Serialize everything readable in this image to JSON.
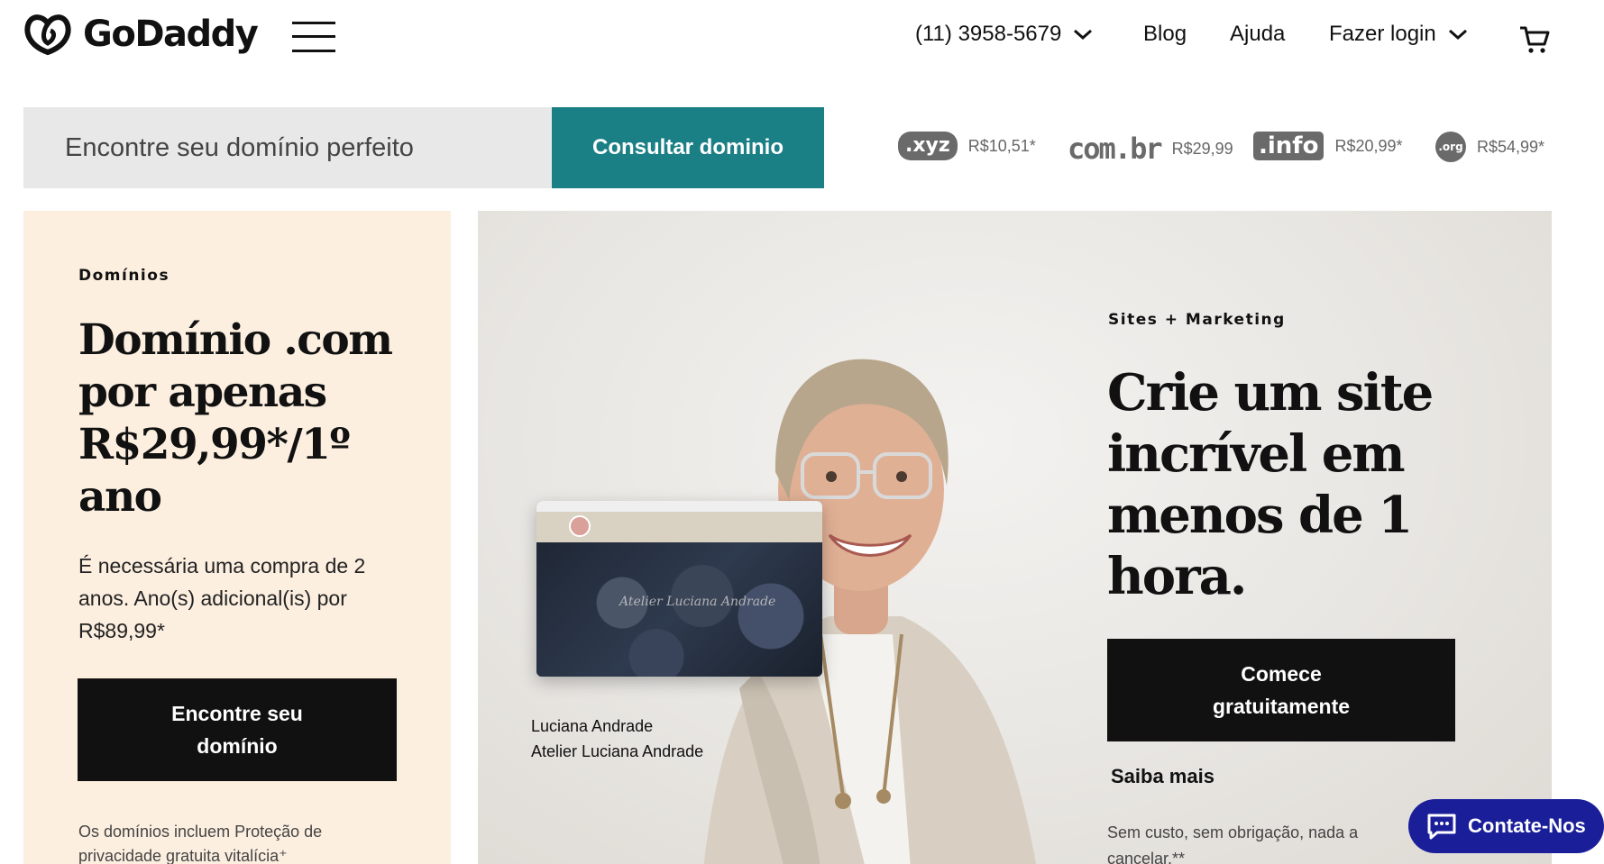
{
  "header": {
    "logo_text": "GoDaddy",
    "phone": "(11) 3958-5679",
    "blog": "Blog",
    "help": "Ajuda",
    "login": "Fazer login"
  },
  "search": {
    "placeholder": "Encontre seu domínio perfeito",
    "button": "Consultar dominio"
  },
  "tlds": [
    {
      "logo": ".xyz",
      "price": "R$10,51*"
    },
    {
      "logo": "com.br",
      "price": "R$29,99"
    },
    {
      "logo": ".info",
      "price": "R$20,99*"
    },
    {
      "logo": ".org",
      "price": "R$54,99*"
    }
  ],
  "domains_card": {
    "eyebrow": "Domínios",
    "title": "Domínio .com por apenas R$29,99*/1º ano",
    "body": "É necessária uma compra de 2 anos. Ano(s) adicional(is) por R$89,99*",
    "button": "Encontre seu domínio",
    "fine_print": "Os domínios incluem Proteção de privacidade gratuita vitalícia⁺"
  },
  "hero": {
    "eyebrow": "Sites + Marketing",
    "title": "Crie um site incrível em menos de 1 hora.",
    "button": "Comece gratuitamente",
    "learn_more": "Saiba mais",
    "note": "Sem custo, sem obrigação, nada a cancelar.**",
    "mock_site_script": "Atelier Luciana Andrade",
    "caption_name": "Luciana Andrade",
    "caption_company": "Atelier Luciana Andrade"
  },
  "chat": {
    "label": "Contate-Nos"
  },
  "colors": {
    "accent": "#1b7f86",
    "card_bg": "#fcefe0",
    "chat": "#1a1e99"
  }
}
